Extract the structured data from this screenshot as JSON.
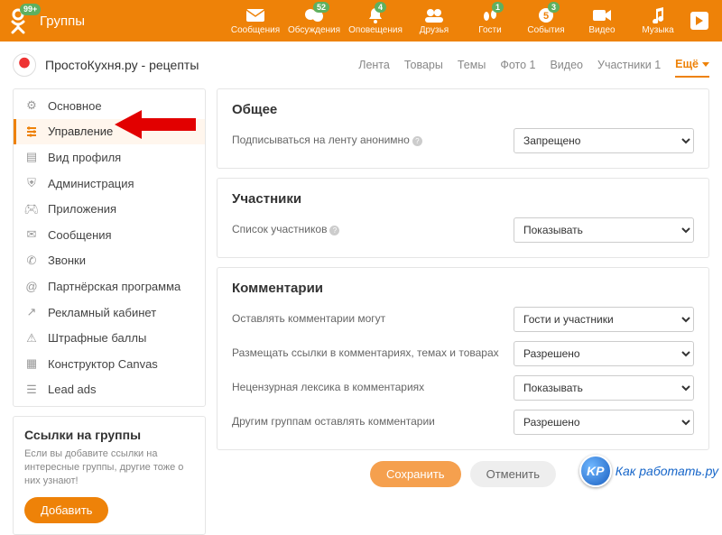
{
  "header": {
    "badge": "99+",
    "groups": "Группы",
    "nav": [
      {
        "key": "messages",
        "label": "Сообщения",
        "count": ""
      },
      {
        "key": "discussions",
        "label": "Обсуждения",
        "count": "52"
      },
      {
        "key": "alerts",
        "label": "Оповещения",
        "count": "4"
      },
      {
        "key": "friends",
        "label": "Друзья",
        "count": ""
      },
      {
        "key": "guests",
        "label": "Гости",
        "count": "1"
      },
      {
        "key": "events",
        "label": "События",
        "count": "3"
      },
      {
        "key": "video",
        "label": "Видео",
        "count": ""
      },
      {
        "key": "music",
        "label": "Музыка",
        "count": ""
      }
    ]
  },
  "group": {
    "title": "ПростоКухня.ру - рецепты"
  },
  "tabs": [
    {
      "label": "Лента"
    },
    {
      "label": "Товары"
    },
    {
      "label": "Темы"
    },
    {
      "label": "Фото 1"
    },
    {
      "label": "Видео"
    },
    {
      "label": "Участники 1"
    },
    {
      "label": "Ещё"
    }
  ],
  "sidebar": {
    "items": [
      {
        "label": "Основное"
      },
      {
        "label": "Управление"
      },
      {
        "label": "Вид профиля"
      },
      {
        "label": "Администрация"
      },
      {
        "label": "Приложения"
      },
      {
        "label": "Сообщения"
      },
      {
        "label": "Звонки"
      },
      {
        "label": "Партнёрская программа"
      },
      {
        "label": "Рекламный кабинет"
      },
      {
        "label": "Штрафные баллы"
      },
      {
        "label": "Конструктор Canvas"
      },
      {
        "label": "Lead ads"
      }
    ],
    "links_title": "Ссылки на группы",
    "links_desc": "Если вы добавите ссылки на интересные группы, другие тоже о них узнают!",
    "add_btn": "Добавить"
  },
  "sections": {
    "general": {
      "title": "Общее",
      "row1_label": "Подписываться на ленту анонимно",
      "row1_value": "Запрещено"
    },
    "members": {
      "title": "Участники",
      "row1_label": "Список участников",
      "row1_value": "Показывать"
    },
    "comments": {
      "title": "Комментарии",
      "row1_label": "Оставлять комментарии могут",
      "row1_value": "Гости и участники",
      "row2_label": "Размещать ссылки в комментариях, темах и товарах",
      "row2_value": "Разрешено",
      "row3_label": "Нецензурная лексика в комментариях",
      "row3_value": "Показывать",
      "row4_label": "Другим группам оставлять комментарии",
      "row4_value": "Разрешено"
    }
  },
  "actions": {
    "save": "Сохранить",
    "cancel": "Отменить"
  },
  "watermark": {
    "badge": "KP",
    "text": "Как работать.ру"
  }
}
